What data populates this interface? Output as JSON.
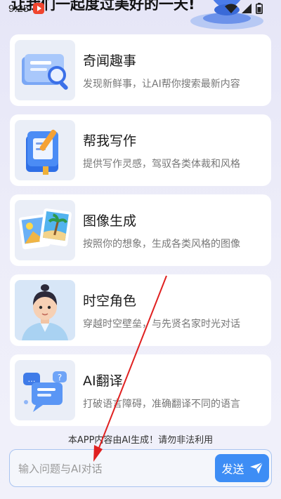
{
  "status_bar": {
    "time": "9:25"
  },
  "header": {
    "title": "让我们一起度过美好的一天!"
  },
  "features": [
    {
      "title": "奇闻趣事",
      "desc": "发现新鲜事，让AI帮你搜索最新内容",
      "icon": "search-document-icon"
    },
    {
      "title": "帮我写作",
      "desc": "提供写作灵感，驾驭各类体裁和风格",
      "icon": "writing-book-icon"
    },
    {
      "title": "图像生成",
      "desc": "按照你的想象，生成各类风格的图像",
      "icon": "image-gallery-icon"
    },
    {
      "title": "时空角色",
      "desc": "穿越时空壁垒，与先贤名家时光对话",
      "icon": "character-avatar-icon"
    },
    {
      "title": "AI翻译",
      "desc": "打破语言障碍，准确翻译不同的语言",
      "icon": "chat-bubbles-icon"
    }
  ],
  "footer": {
    "notice": "本APP内容由AI生成！请勿非法利用",
    "input_placeholder": "输入问题与AI对话",
    "send_label": "发送"
  },
  "colors": {
    "accent": "#3d8df5",
    "arrow": "#e02020"
  }
}
